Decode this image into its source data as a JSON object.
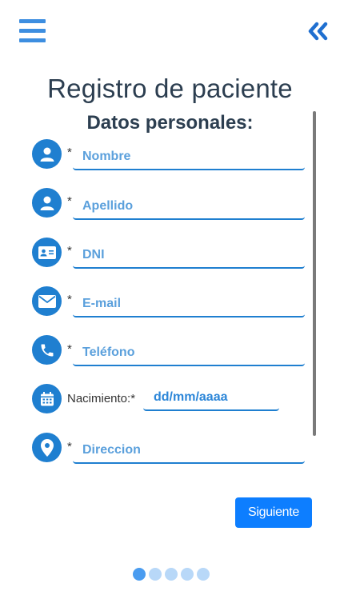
{
  "header": {
    "menu_icon": "hamburger-menu-icon",
    "back_icon": "double-chevron-left-icon"
  },
  "page": {
    "title": "Registro de paciente",
    "subtitle": "Datos personales:"
  },
  "form": {
    "required_mark": "*",
    "fields": [
      {
        "icon": "user-icon",
        "placeholder": "Nombre",
        "value": ""
      },
      {
        "icon": "user-icon",
        "placeholder": "Apellido",
        "value": ""
      },
      {
        "icon": "id-card-icon",
        "placeholder": "DNI",
        "value": ""
      },
      {
        "icon": "envelope-icon",
        "placeholder": "E-mail",
        "value": ""
      },
      {
        "icon": "phone-icon",
        "placeholder": "Teléfono",
        "value": ""
      },
      {
        "icon": "location-pin-icon",
        "placeholder": "Direccion",
        "value": ""
      }
    ],
    "birth": {
      "icon": "calendar-icon",
      "label": "Nacimiento:*",
      "placeholder": "dd/mm/aaaa",
      "value": ""
    },
    "next_label": "Siguiente"
  },
  "pagination": {
    "total": 5,
    "current": 1
  },
  "colors": {
    "accent": "#1f7fd0",
    "button": "#0d7eff",
    "text": "#2c3e50",
    "dot_active": "#4a9cf0",
    "dot_inactive": "#b8d8f8"
  }
}
